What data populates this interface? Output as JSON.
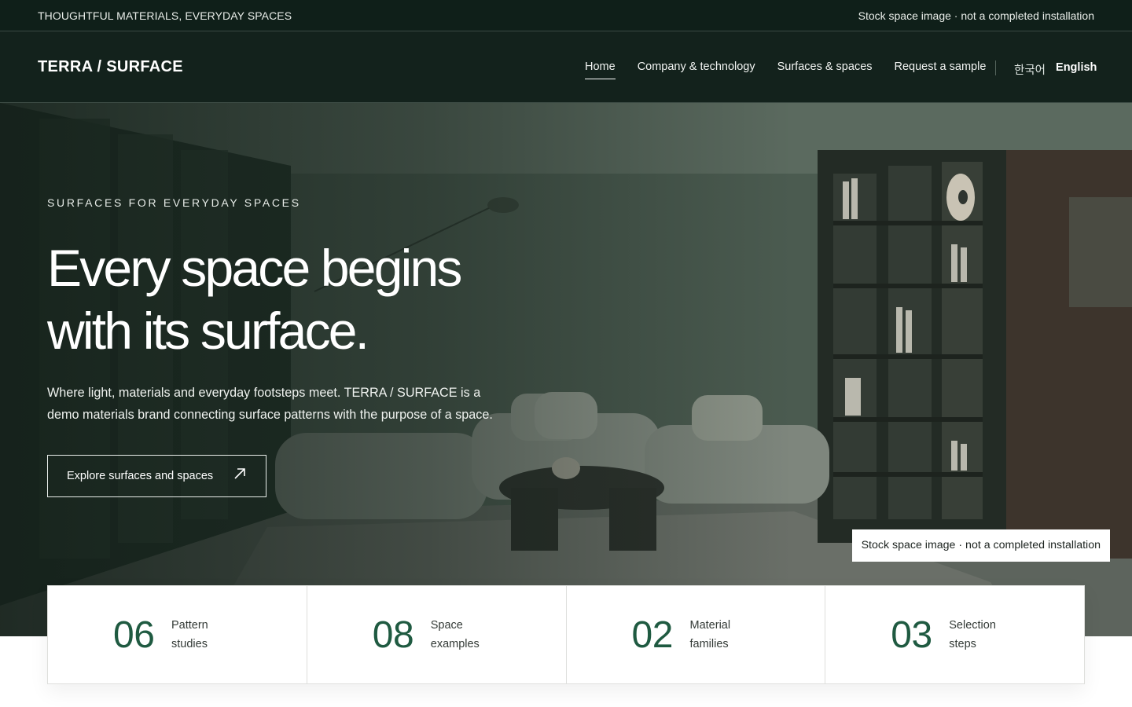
{
  "topbar": {
    "tagline": "THOUGHTFUL MATERIALS, EVERYDAY SPACES",
    "notice": "Stock space image · not a completed installation"
  },
  "header": {
    "brand": "TERRA / SURFACE",
    "menu": [
      {
        "label": "Home",
        "active": true
      },
      {
        "label": "Company & technology",
        "active": false
      },
      {
        "label": "Surfaces & spaces",
        "active": false
      },
      {
        "label": "Request a sample",
        "active": false
      }
    ],
    "languages": [
      {
        "label": "한국어",
        "active": false
      },
      {
        "label": "English",
        "active": true
      }
    ]
  },
  "hero": {
    "eyebrow": "SURFACES FOR EVERYDAY SPACES",
    "headline_line1": "Every space begins",
    "headline_line2": "with its surface.",
    "subtext": "Where light, materials and everyday footsteps meet. TERRA / SURFACE is a demo materials brand connecting surface patterns with the purpose of a space.",
    "cta_label": "Explore surfaces and spaces",
    "cta_icon": "arrow-up-right-icon",
    "image_caption": "Stock space image · not a completed installation"
  },
  "stats": [
    {
      "number": "06",
      "line1": "Pattern",
      "line2": "studies"
    },
    {
      "number": "08",
      "line1": "Space",
      "line2": "examples"
    },
    {
      "number": "02",
      "line1": "Material",
      "line2": "families"
    },
    {
      "number": "03",
      "line1": "Selection",
      "line2": "steps"
    }
  ],
  "colors": {
    "dark_green": "#13221c",
    "accent_green": "#1f5a41",
    "white": "#ffffff"
  }
}
